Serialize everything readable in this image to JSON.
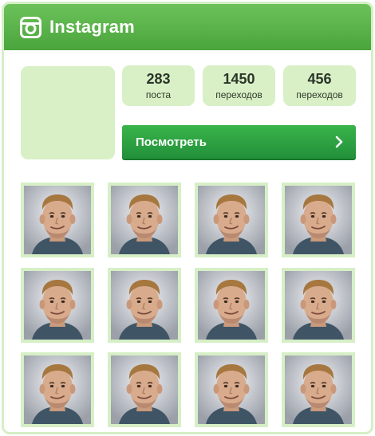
{
  "header": {
    "title": "Instagram",
    "icon": "instagram-icon",
    "bg_color": "#5cb84a"
  },
  "profile": {
    "avatar_placeholder_color": "#d9f0c6"
  },
  "stats": [
    {
      "value": "283",
      "label": "поста"
    },
    {
      "value": "1450",
      "label": "переходов"
    },
    {
      "value": "456",
      "label": "переходов"
    }
  ],
  "view_button": {
    "label": "Посмотреть",
    "icon": "chevron-right-icon",
    "color": "#2ea442"
  },
  "photos": {
    "count": 12,
    "columns": 4,
    "rows": 3,
    "subject": "smiling man portrait"
  }
}
